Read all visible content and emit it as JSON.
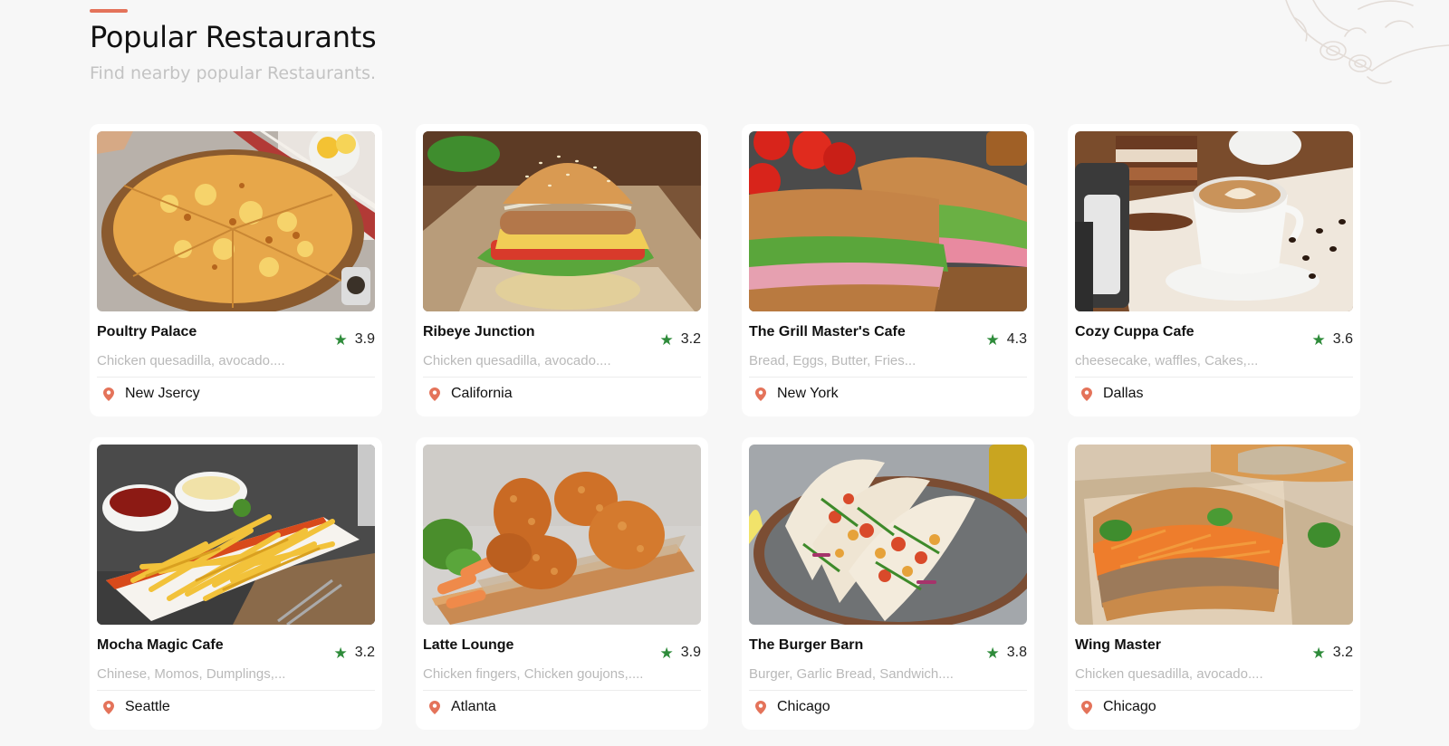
{
  "header": {
    "title": "Popular Restaurants",
    "subtitle": "Find nearby popular Restaurants."
  },
  "colors": {
    "accent": "#e4735a",
    "star": "#2e8b3a",
    "pin": "#e4735a"
  },
  "restaurants": [
    {
      "name": "Poultry Palace",
      "rating": "3.9",
      "tags": "Chicken quesadilla, avocado....",
      "city": "New Jsercy",
      "image": "pizza"
    },
    {
      "name": "Ribeye Junction",
      "rating": "3.2",
      "tags": "Chicken quesadilla, avocado....",
      "city": "California",
      "image": "burger"
    },
    {
      "name": "The Grill Master's Cafe",
      "rating": "4.3",
      "tags": "Bread, Eggs, Butter, Fries...",
      "city": "New York",
      "image": "sandwich"
    },
    {
      "name": "Cozy Cuppa Cafe",
      "rating": "3.6",
      "tags": "cheesecake, waffles, Cakes,...",
      "city": "Dallas",
      "image": "coffee"
    },
    {
      "name": "Mocha Magic Cafe",
      "rating": "3.2",
      "tags": "Chinese, Momos, Dumplings,...",
      "city": "Seattle",
      "image": "fries"
    },
    {
      "name": "Latte Lounge",
      "rating": "3.9",
      "tags": "Chicken fingers, Chicken goujons,....",
      "city": "Atlanta",
      "image": "fried-chicken"
    },
    {
      "name": "The Burger Barn",
      "rating": "3.8",
      "tags": "Burger, Garlic Bread, Sandwich....",
      "city": "Chicago",
      "image": "tacos"
    },
    {
      "name": "Wing Master",
      "rating": "3.2",
      "tags": "Chicken quesadilla, avocado....",
      "city": "Chicago",
      "image": "banh-mi"
    }
  ]
}
